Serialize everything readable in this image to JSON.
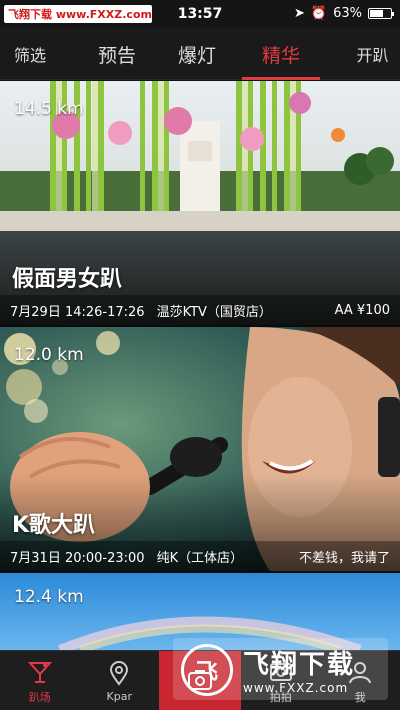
{
  "status_bar": {
    "watermark": "飞翔下载 www.FXXZ.com",
    "time": "13:57",
    "battery": "63%",
    "battery_level": 0.63
  },
  "tabs": {
    "filter": "筛选",
    "items": [
      "预告",
      "爆灯",
      "精华"
    ],
    "active_index": 2,
    "right": "开趴"
  },
  "cards": [
    {
      "distance": "14.5 km",
      "title": "假面男女趴",
      "date": "7月29日 14:26-17:26",
      "venue": "温莎KTV（国贸店）",
      "price": "AA ¥100"
    },
    {
      "distance": "12.0 km",
      "title": "K歌大趴",
      "date": "7月31日 20:00-23:00",
      "venue": "纯K（工体店）",
      "price": "不差钱，我请了"
    },
    {
      "distance": "12.4 km"
    }
  ],
  "bottom_nav": {
    "items": [
      {
        "label": "趴场",
        "icon": "cocktail-icon"
      },
      {
        "label": "Kpar",
        "icon": "location-pin-icon"
      },
      {
        "label": "",
        "icon": "camera-icon"
      },
      {
        "label": "拍拍",
        "icon": "photo-icon"
      },
      {
        "label": "我",
        "icon": "user-icon"
      }
    ],
    "active_index": 0
  },
  "watermark_bottom": {
    "name": "飞翔下载",
    "url": "www.FXXZ.com"
  },
  "colors": {
    "accent": "#e23a43",
    "header_bg": "#1a1a1a",
    "nav_bg": "#1e1e1e"
  }
}
